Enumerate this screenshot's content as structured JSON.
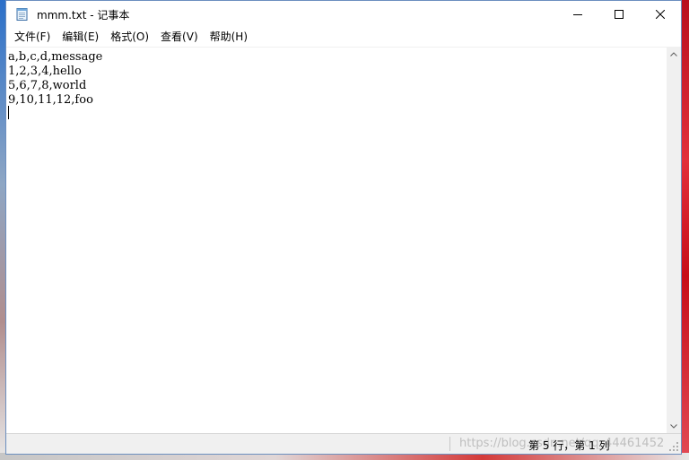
{
  "window": {
    "title": "mmm.txt - 记事本"
  },
  "menu": {
    "items": [
      {
        "label": "文件(F)"
      },
      {
        "label": "编辑(E)"
      },
      {
        "label": "格式(O)"
      },
      {
        "label": "查看(V)"
      },
      {
        "label": "帮助(H)"
      }
    ]
  },
  "editor": {
    "lines": [
      "a,b,c,d,message",
      "1,2,3,4,hello",
      "5,6,7,8,world",
      "9,10,11,12,foo"
    ]
  },
  "status": {
    "position": "第 5 行，第 1 列",
    "watermark": "https://blog.csdn.net/qq_44461452"
  },
  "icons": {
    "app": "notepad-icon",
    "minimize": "minimize-icon",
    "maximize": "maximize-icon",
    "close": "close-icon"
  },
  "colors": {
    "window_border": "#6c8fbf",
    "statusbar_bg": "#f0f0f0"
  }
}
